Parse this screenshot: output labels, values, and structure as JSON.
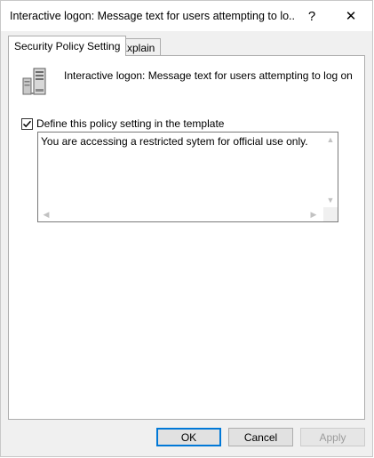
{
  "window": {
    "title": "Interactive logon: Message text for users attempting to lo...",
    "help_glyph": "?",
    "close_glyph": "✕"
  },
  "tabs": [
    {
      "label": "Security Policy Setting",
      "active": true
    },
    {
      "label": "Explain",
      "active": false
    }
  ],
  "panel": {
    "policy_title": "Interactive logon: Message text for users attempting to log on",
    "icon": "server-policy-icon",
    "define_checkbox": {
      "label": "Define this policy setting in the template",
      "checked": true
    },
    "message_text": "You are accessing a restricted sytem for official use only."
  },
  "buttons": {
    "ok": "OK",
    "cancel": "Cancel",
    "apply": "Apply"
  },
  "colors": {
    "window_bg": "#f0f0f0",
    "accent": "#0078d7",
    "disabled_text": "#9c9c9c"
  }
}
